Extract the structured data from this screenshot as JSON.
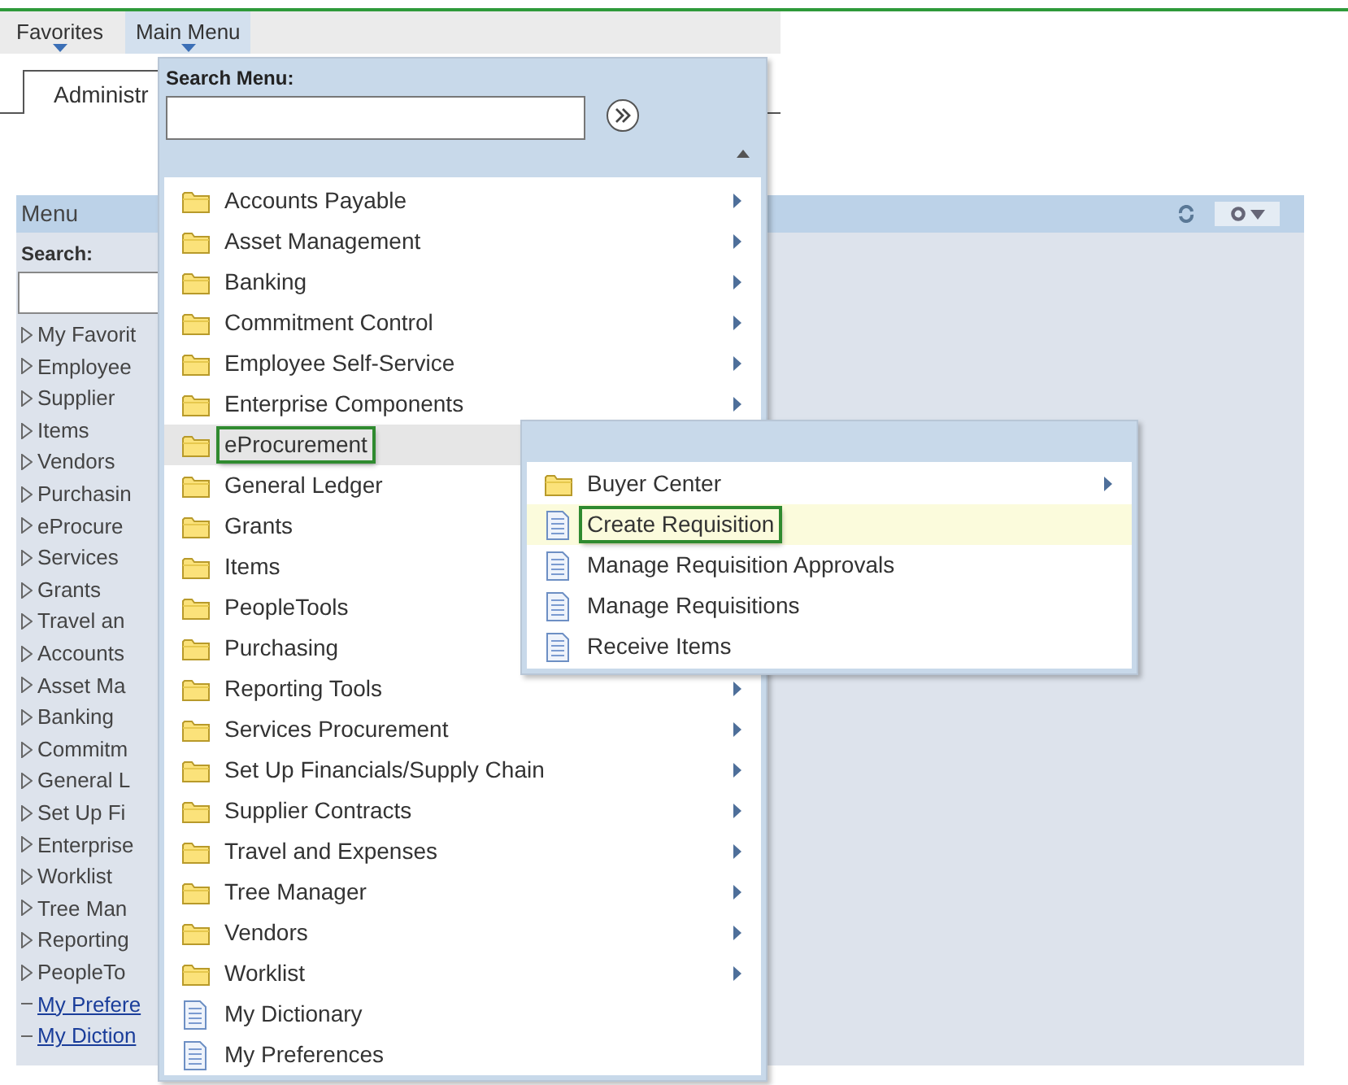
{
  "nav": [
    {
      "label": "Favorites",
      "selected": false
    },
    {
      "label": "Main Menu",
      "selected": true
    }
  ],
  "tab": {
    "label": "Administr"
  },
  "pagelet": {
    "title": "Menu",
    "search_label": "Search:",
    "items": [
      {
        "label": "My Favorit",
        "kind": "folder"
      },
      {
        "label": "Employee",
        "kind": "folder"
      },
      {
        "label": "Supplier",
        "kind": "folder"
      },
      {
        "label": "Items",
        "kind": "folder"
      },
      {
        "label": "Vendors",
        "kind": "folder"
      },
      {
        "label": "Purchasin",
        "kind": "folder"
      },
      {
        "label": "eProcure",
        "kind": "folder"
      },
      {
        "label": "Services",
        "kind": "folder"
      },
      {
        "label": "Grants",
        "kind": "folder"
      },
      {
        "label": "Travel an",
        "kind": "folder"
      },
      {
        "label": "Accounts",
        "kind": "folder"
      },
      {
        "label": "Asset Ma",
        "kind": "folder"
      },
      {
        "label": "Banking",
        "kind": "folder"
      },
      {
        "label": "Commitm",
        "kind": "folder"
      },
      {
        "label": "General L",
        "kind": "folder"
      },
      {
        "label": "Set Up Fi",
        "kind": "folder"
      },
      {
        "label": "Enterprise",
        "kind": "folder"
      },
      {
        "label": "Worklist",
        "kind": "folder"
      },
      {
        "label": "Tree Man",
        "kind": "folder"
      },
      {
        "label": "Reporting",
        "kind": "folder"
      },
      {
        "label": "PeopleTo",
        "kind": "folder"
      },
      {
        "label": "My Prefere",
        "kind": "link"
      },
      {
        "label": "My Diction",
        "kind": "link"
      }
    ]
  },
  "main_menu": {
    "search_label": "Search Menu:",
    "items": [
      {
        "label": "Accounts Payable",
        "kind": "folder",
        "selected": false,
        "outlined": false
      },
      {
        "label": "Asset Management",
        "kind": "folder",
        "selected": false,
        "outlined": false
      },
      {
        "label": "Banking",
        "kind": "folder",
        "selected": false,
        "outlined": false
      },
      {
        "label": "Commitment Control",
        "kind": "folder",
        "selected": false,
        "outlined": false
      },
      {
        "label": "Employee Self-Service",
        "kind": "folder",
        "selected": false,
        "outlined": false
      },
      {
        "label": "Enterprise Components",
        "kind": "folder",
        "selected": false,
        "outlined": false
      },
      {
        "label": "eProcurement",
        "kind": "folder",
        "selected": true,
        "outlined": true
      },
      {
        "label": "General Ledger",
        "kind": "folder",
        "selected": false,
        "outlined": false
      },
      {
        "label": "Grants",
        "kind": "folder",
        "selected": false,
        "outlined": false
      },
      {
        "label": "Items",
        "kind": "folder",
        "selected": false,
        "outlined": false
      },
      {
        "label": "PeopleTools",
        "kind": "folder",
        "selected": false,
        "outlined": false
      },
      {
        "label": "Purchasing",
        "kind": "folder",
        "selected": false,
        "outlined": false
      },
      {
        "label": "Reporting Tools",
        "kind": "folder",
        "selected": false,
        "outlined": false
      },
      {
        "label": "Services Procurement",
        "kind": "folder",
        "selected": false,
        "outlined": false
      },
      {
        "label": "Set Up Financials/Supply Chain",
        "kind": "folder",
        "selected": false,
        "outlined": false
      },
      {
        "label": "Supplier Contracts",
        "kind": "folder",
        "selected": false,
        "outlined": false
      },
      {
        "label": "Travel and Expenses",
        "kind": "folder",
        "selected": false,
        "outlined": false
      },
      {
        "label": "Tree Manager",
        "kind": "folder",
        "selected": false,
        "outlined": false
      },
      {
        "label": "Vendors",
        "kind": "folder",
        "selected": false,
        "outlined": false
      },
      {
        "label": "Worklist",
        "kind": "folder",
        "selected": false,
        "outlined": false
      },
      {
        "label": "My Dictionary",
        "kind": "page",
        "selected": false,
        "outlined": false
      },
      {
        "label": "My Preferences",
        "kind": "page",
        "selected": false,
        "outlined": false
      }
    ]
  },
  "submenu": {
    "items": [
      {
        "label": "Buyer Center",
        "kind": "folder",
        "selected": false,
        "outlined": false
      },
      {
        "label": "Create Requisition",
        "kind": "page",
        "selected": true,
        "outlined": true
      },
      {
        "label": "Manage Requisition Approvals",
        "kind": "page",
        "selected": false,
        "outlined": false
      },
      {
        "label": "Manage Requisitions",
        "kind": "page",
        "selected": false,
        "outlined": false
      },
      {
        "label": "Receive Items",
        "kind": "page",
        "selected": false,
        "outlined": false
      }
    ]
  }
}
